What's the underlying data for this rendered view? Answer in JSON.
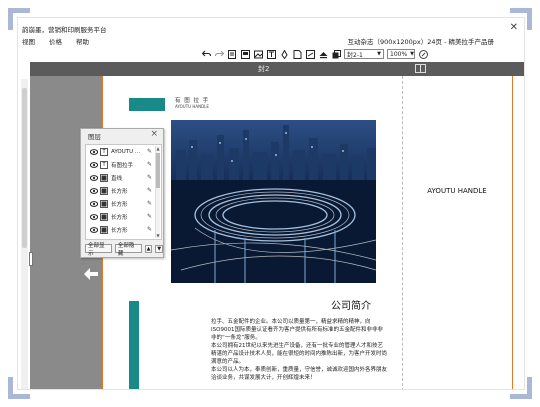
{
  "app": {
    "title": "韵崩墨，营销和印刷服务平台",
    "menu": [
      "视图",
      "价格",
      "帮助"
    ],
    "doc_title": "互动杂志（900x1200px）24页 - 精美拉手产品册",
    "close_glyph": "✕"
  },
  "toolbar": {
    "icons": [
      "undo-icon",
      "redo-icon",
      "save-page-icon",
      "template-icon",
      "image-icon",
      "text-icon",
      "pen-icon",
      "page-icon",
      "link-icon",
      "layers-icon",
      "duplicate-icon"
    ],
    "page_select": "封2-1",
    "zoom_select": "100%"
  },
  "pagebar": {
    "label": "封2"
  },
  "layers": {
    "title": "图层",
    "items": [
      {
        "type": "T",
        "name": "AYOUTU ..."
      },
      {
        "type": "T",
        "name": "有图拉手"
      },
      {
        "type": "img",
        "name": "直线"
      },
      {
        "type": "img",
        "name": "长方形"
      },
      {
        "type": "img",
        "name": "长方形"
      },
      {
        "type": "img",
        "name": "长方形"
      },
      {
        "type": "img",
        "name": "长方形"
      }
    ],
    "show_all": "全部显示",
    "hide_all": "全部隐藏"
  },
  "document": {
    "brand_cn": "有 图 拉 手",
    "brand_en": "AYOUTU HANDLE",
    "section_title": "公司简介",
    "paragraphs": [
      "拉手、五金配件的企业。本公司以质量第一，精益求精的精神，向ISO9001国际质量认证看齐为客户提供有所有标准的五金配件和非非非非的“一条龙”服务。",
      "本公司拥有21世纪以来先进生产设备，还有一批专业的管理人才和技艺精湛的产品设计技术人员，能在很短的时间内推陈出新，为客户开发时尚满意的产品。",
      "本公司以人为本，奉质创新，重质量，守信誉，诚诚欢迎国内外各界朋友洽谈业务，共谋发展大计，开创辉煌未来！"
    ],
    "right_title": "AYOUTU HANDLE"
  },
  "colors": {
    "accent_teal": "#1a8a88",
    "page_border": "#e07b2a",
    "dark_bar": "#5b5b5b"
  }
}
